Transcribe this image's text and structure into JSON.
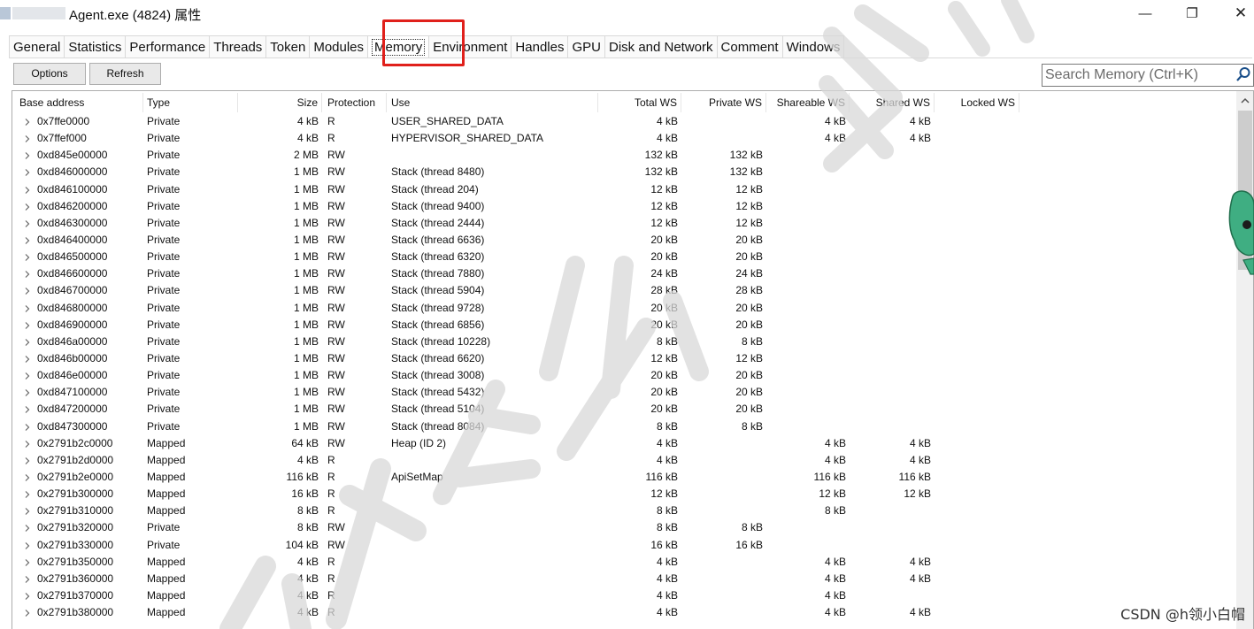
{
  "window": {
    "title": "Agent.exe (4824) 属性",
    "controls": {
      "minimize": "—",
      "maximize": "❐",
      "close": "✕"
    }
  },
  "tabs": [
    {
      "label": "General"
    },
    {
      "label": "Statistics"
    },
    {
      "label": "Performance"
    },
    {
      "label": "Threads"
    },
    {
      "label": "Token"
    },
    {
      "label": "Modules"
    },
    {
      "label": "Memory",
      "active": true
    },
    {
      "label": "Environment"
    },
    {
      "label": "Handles"
    },
    {
      "label": "GPU"
    },
    {
      "label": "Disk and Network"
    },
    {
      "label": "Comment"
    },
    {
      "label": "Windows"
    }
  ],
  "toolbar": {
    "options_label": "Options",
    "refresh_label": "Refresh",
    "search_placeholder": "Search Memory (Ctrl+K)"
  },
  "table": {
    "headers": {
      "base": "Base address",
      "type": "Type",
      "size": "Size",
      "protection": "Protection",
      "use": "Use",
      "total_ws": "Total WS",
      "private_ws": "Private WS",
      "shareable_ws": "Shareable WS",
      "shared_ws": "Shared WS",
      "locked_ws": "Locked WS"
    },
    "rows": [
      {
        "base": "0x7ffe0000",
        "type": "Private",
        "size": "4 kB",
        "prot": "R",
        "use": "USER_SHARED_DATA",
        "tws": "4 kB",
        "pws": "",
        "shws": "4 kB",
        "sws": "4 kB"
      },
      {
        "base": "0x7ffef000",
        "type": "Private",
        "size": "4 kB",
        "prot": "R",
        "use": "HYPERVISOR_SHARED_DATA",
        "tws": "4 kB",
        "pws": "",
        "shws": "4 kB",
        "sws": "4 kB"
      },
      {
        "base": "0xd845e00000",
        "type": "Private",
        "size": "2 MB",
        "prot": "RW",
        "use": "",
        "tws": "132 kB",
        "pws": "132 kB",
        "shws": "",
        "sws": ""
      },
      {
        "base": "0xd846000000",
        "type": "Private",
        "size": "1 MB",
        "prot": "RW",
        "use": "Stack (thread 8480)",
        "tws": "132 kB",
        "pws": "132 kB",
        "shws": "",
        "sws": ""
      },
      {
        "base": "0xd846100000",
        "type": "Private",
        "size": "1 MB",
        "prot": "RW",
        "use": "Stack (thread 204)",
        "tws": "12 kB",
        "pws": "12 kB",
        "shws": "",
        "sws": ""
      },
      {
        "base": "0xd846200000",
        "type": "Private",
        "size": "1 MB",
        "prot": "RW",
        "use": "Stack (thread 9400)",
        "tws": "12 kB",
        "pws": "12 kB",
        "shws": "",
        "sws": ""
      },
      {
        "base": "0xd846300000",
        "type": "Private",
        "size": "1 MB",
        "prot": "RW",
        "use": "Stack (thread 2444)",
        "tws": "12 kB",
        "pws": "12 kB",
        "shws": "",
        "sws": ""
      },
      {
        "base": "0xd846400000",
        "type": "Private",
        "size": "1 MB",
        "prot": "RW",
        "use": "Stack (thread 6636)",
        "tws": "20 kB",
        "pws": "20 kB",
        "shws": "",
        "sws": ""
      },
      {
        "base": "0xd846500000",
        "type": "Private",
        "size": "1 MB",
        "prot": "RW",
        "use": "Stack (thread 6320)",
        "tws": "20 kB",
        "pws": "20 kB",
        "shws": "",
        "sws": ""
      },
      {
        "base": "0xd846600000",
        "type": "Private",
        "size": "1 MB",
        "prot": "RW",
        "use": "Stack (thread 7880)",
        "tws": "24 kB",
        "pws": "24 kB",
        "shws": "",
        "sws": ""
      },
      {
        "base": "0xd846700000",
        "type": "Private",
        "size": "1 MB",
        "prot": "RW",
        "use": "Stack (thread 5904)",
        "tws": "28 kB",
        "pws": "28 kB",
        "shws": "",
        "sws": ""
      },
      {
        "base": "0xd846800000",
        "type": "Private",
        "size": "1 MB",
        "prot": "RW",
        "use": "Stack (thread 9728)",
        "tws": "20 kB",
        "pws": "20 kB",
        "shws": "",
        "sws": ""
      },
      {
        "base": "0xd846900000",
        "type": "Private",
        "size": "1 MB",
        "prot": "RW",
        "use": "Stack (thread 6856)",
        "tws": "20 kB",
        "pws": "20 kB",
        "shws": "",
        "sws": ""
      },
      {
        "base": "0xd846a00000",
        "type": "Private",
        "size": "1 MB",
        "prot": "RW",
        "use": "Stack (thread 10228)",
        "tws": "8 kB",
        "pws": "8 kB",
        "shws": "",
        "sws": ""
      },
      {
        "base": "0xd846b00000",
        "type": "Private",
        "size": "1 MB",
        "prot": "RW",
        "use": "Stack (thread 6620)",
        "tws": "12 kB",
        "pws": "12 kB",
        "shws": "",
        "sws": ""
      },
      {
        "base": "0xd846e00000",
        "type": "Private",
        "size": "1 MB",
        "prot": "RW",
        "use": "Stack (thread 3008)",
        "tws": "20 kB",
        "pws": "20 kB",
        "shws": "",
        "sws": ""
      },
      {
        "base": "0xd847100000",
        "type": "Private",
        "size": "1 MB",
        "prot": "RW",
        "use": "Stack (thread 5432)",
        "tws": "20 kB",
        "pws": "20 kB",
        "shws": "",
        "sws": ""
      },
      {
        "base": "0xd847200000",
        "type": "Private",
        "size": "1 MB",
        "prot": "RW",
        "use": "Stack (thread 5104)",
        "tws": "20 kB",
        "pws": "20 kB",
        "shws": "",
        "sws": ""
      },
      {
        "base": "0xd847300000",
        "type": "Private",
        "size": "1 MB",
        "prot": "RW",
        "use": "Stack (thread 8084)",
        "tws": "8 kB",
        "pws": "8 kB",
        "shws": "",
        "sws": ""
      },
      {
        "base": "0x2791b2c0000",
        "type": "Mapped",
        "size": "64 kB",
        "prot": "RW",
        "use": "Heap (ID 2)",
        "tws": "4 kB",
        "pws": "",
        "shws": "4 kB",
        "sws": "4 kB"
      },
      {
        "base": "0x2791b2d0000",
        "type": "Mapped",
        "size": "4 kB",
        "prot": "R",
        "use": "",
        "tws": "4 kB",
        "pws": "",
        "shws": "4 kB",
        "sws": "4 kB"
      },
      {
        "base": "0x2791b2e0000",
        "type": "Mapped",
        "size": "116 kB",
        "prot": "R",
        "use": "ApiSetMap",
        "tws": "116 kB",
        "pws": "",
        "shws": "116 kB",
        "sws": "116 kB"
      },
      {
        "base": "0x2791b300000",
        "type": "Mapped",
        "size": "16 kB",
        "prot": "R",
        "use": "",
        "tws": "12 kB",
        "pws": "",
        "shws": "12 kB",
        "sws": "12 kB"
      },
      {
        "base": "0x2791b310000",
        "type": "Mapped",
        "size": "8 kB",
        "prot": "R",
        "use": "",
        "tws": "8 kB",
        "pws": "",
        "shws": "8 kB",
        "sws": ""
      },
      {
        "base": "0x2791b320000",
        "type": "Private",
        "size": "8 kB",
        "prot": "RW",
        "use": "",
        "tws": "8 kB",
        "pws": "8 kB",
        "shws": "",
        "sws": ""
      },
      {
        "base": "0x2791b330000",
        "type": "Private",
        "size": "104 kB",
        "prot": "RW",
        "use": "",
        "tws": "16 kB",
        "pws": "16 kB",
        "shws": "",
        "sws": ""
      },
      {
        "base": "0x2791b350000",
        "type": "Mapped",
        "size": "4 kB",
        "prot": "R",
        "use": "",
        "tws": "4 kB",
        "pws": "",
        "shws": "4 kB",
        "sws": "4 kB"
      },
      {
        "base": "0x2791b360000",
        "type": "Mapped",
        "size": "4 kB",
        "prot": "R",
        "use": "",
        "tws": "4 kB",
        "pws": "",
        "shws": "4 kB",
        "sws": "4 kB"
      },
      {
        "base": "0x2791b370000",
        "type": "Mapped",
        "size": "4 kB",
        "prot": "R",
        "use": "",
        "tws": "4 kB",
        "pws": "",
        "shws": "4 kB",
        "sws": ""
      },
      {
        "base": "0x2791b380000",
        "type": "Mapped",
        "size": "4 kB",
        "prot": "R",
        "use": "",
        "tws": "4 kB",
        "pws": "",
        "shws": "4 kB",
        "sws": "4 kB"
      }
    ]
  },
  "watermark": {
    "text": "CSDN @h领小白帽"
  },
  "colors": {
    "highlight": "#e0201b",
    "watermark_stroke": "#dcdcdc"
  },
  "icons": {
    "search": "search-icon",
    "expand": "chevron-right-icon"
  }
}
